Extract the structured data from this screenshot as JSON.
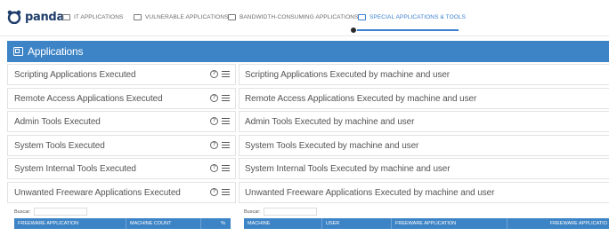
{
  "brand": {
    "name": "panda",
    "color": "#1f3d6b"
  },
  "nav": {
    "tabs": [
      {
        "label": "IT APPLICATIONS",
        "icon": "window-icon",
        "active": false
      },
      {
        "label": "VULNERABLE APPLICATIONS",
        "icon": "window-icon",
        "active": false
      },
      {
        "label": "BANDWIDTH-CONSUMING APPLICATIONS",
        "icon": "window-icon",
        "active": false
      },
      {
        "label": "SPECIAL APPLICATIONS & TOOLS",
        "icon": "window-icon",
        "active": true
      }
    ]
  },
  "header": {
    "title": "Applications",
    "icon": "applications-icon",
    "color": "#3d84c6"
  },
  "rows": [
    {
      "left": "Scripting Applications Executed",
      "right": "Scripting Applications Executed by machine and user"
    },
    {
      "left": "Remote Access Applications Executed",
      "right": "Remote Access Applications Executed by machine and user"
    },
    {
      "left": "Admin Tools Executed",
      "right": "Admin Tools Executed by machine and user"
    },
    {
      "left": "System Tools Executed",
      "right": "System Tools Executed by machine and user"
    },
    {
      "left": "System Internal Tools Executed",
      "right": "System Internal Tools Executed by machine and user"
    },
    {
      "left": "Unwanted Freeware Applications Executed",
      "right": "Unwanted Freeware Applications Executed by machine and user"
    }
  ],
  "left_table": {
    "search_label": "Buscar:",
    "columns": [
      "FREEWARE APPLICATION",
      "MACHINE COUNT",
      "%"
    ]
  },
  "right_table": {
    "search_label": "Buscar:",
    "columns": [
      "MACHINE",
      "USER",
      "FREEWARE APPLICATION",
      "FREEWARE APPLICATIO"
    ]
  }
}
